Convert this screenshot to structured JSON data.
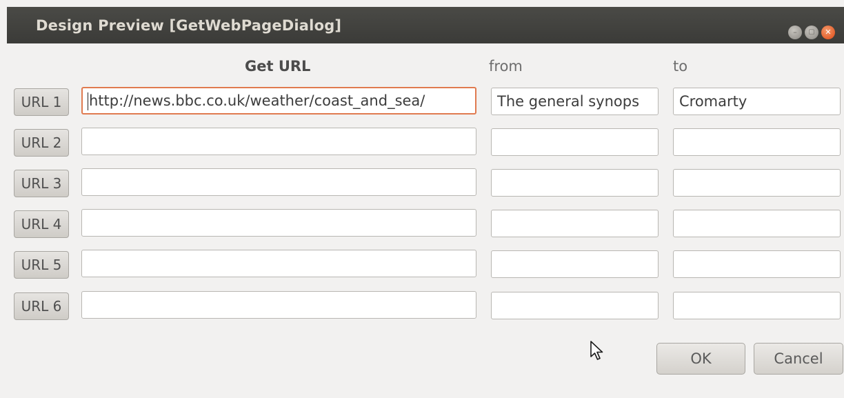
{
  "window": {
    "title": "Design Preview [GetWebPageDialog]",
    "controls": {
      "minimize": "–",
      "maximize": "▢",
      "close": "✕"
    }
  },
  "headers": {
    "url": "Get URL",
    "from": "from",
    "to": "to"
  },
  "rows": [
    {
      "button": "URL 1",
      "url": "http://news.bbc.co.uk/weather/coast_and_sea/",
      "from": "The general synops",
      "to": "Cromarty"
    },
    {
      "button": "URL 2",
      "url": "",
      "from": "",
      "to": ""
    },
    {
      "button": "URL 3",
      "url": "",
      "from": "",
      "to": ""
    },
    {
      "button": "URL 4",
      "url": "",
      "from": "",
      "to": ""
    },
    {
      "button": "URL 5",
      "url": "",
      "from": "",
      "to": ""
    },
    {
      "button": "URL 6",
      "url": "",
      "from": "",
      "to": ""
    }
  ],
  "buttons": {
    "ok": "OK",
    "cancel": "Cancel"
  },
  "colors": {
    "titlebar": "#3c3b37",
    "focus_border": "#e07a4f",
    "close_button": "#dd4814"
  },
  "icons": {
    "pointer": "mouse-pointer-icon"
  }
}
